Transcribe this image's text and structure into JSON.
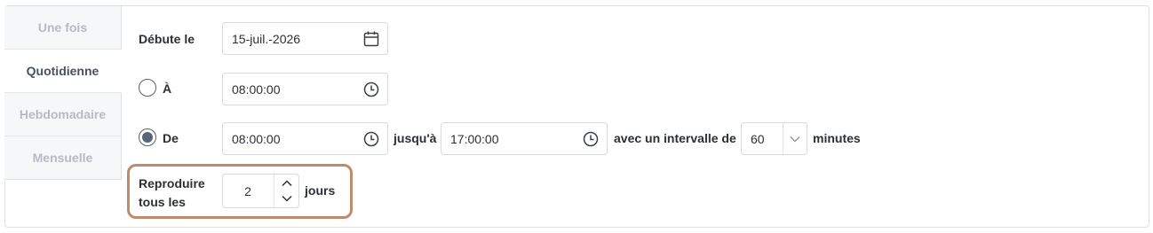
{
  "tabs": [
    {
      "label": "Une fois",
      "active": false
    },
    {
      "label": "Quotidienne",
      "active": true
    },
    {
      "label": "Hebdomadaire",
      "active": false
    },
    {
      "label": "Mensuelle",
      "active": false
    }
  ],
  "start": {
    "label": "Débute le",
    "date": "15-juil.-2026",
    "icon": "calendar-icon"
  },
  "at": {
    "label": "À",
    "time": "08:00:00",
    "selected": false,
    "icon": "clock-icon"
  },
  "from": {
    "label": "De",
    "selected": true,
    "start_time": "08:00:00",
    "until_label": "jusqu'à",
    "end_time": "17:00:00",
    "interval_label": "avec un intervalle de",
    "interval_value": "60",
    "interval_unit": "minutes"
  },
  "repeat": {
    "label_line1": "Reproduire",
    "label_line2": "tous les",
    "value": "2",
    "unit": "jours",
    "highlight_color": "#c08a6c"
  }
}
